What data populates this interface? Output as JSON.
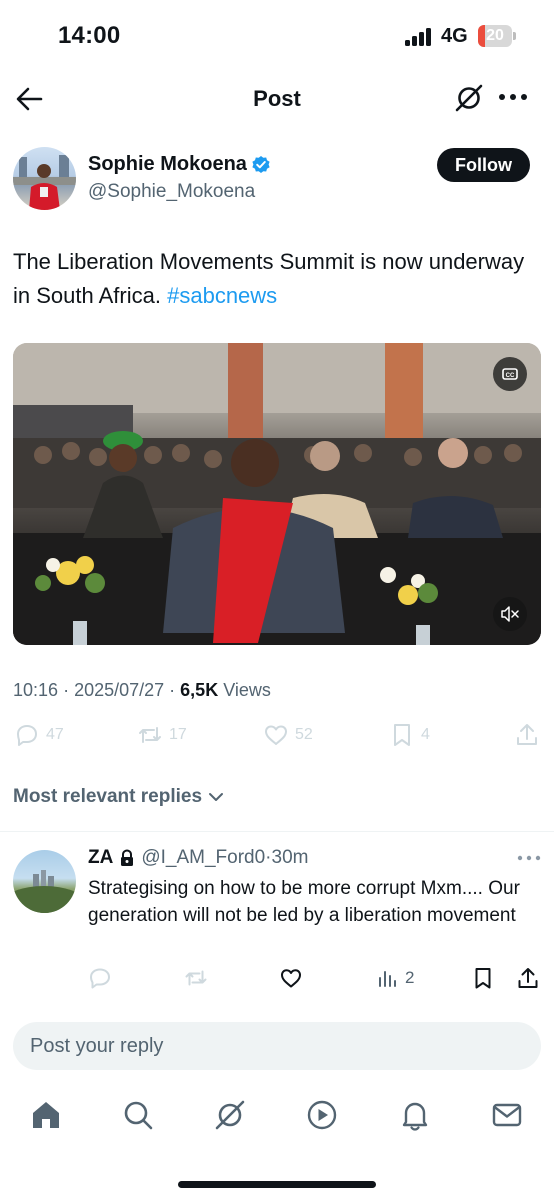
{
  "status_bar": {
    "time": "14:00",
    "network": "4G",
    "battery_level": "20",
    "battery_fraction": 0.2,
    "battery_color": "#eb4d3d"
  },
  "header": {
    "title": "Post",
    "back_icon": "arrow-left-icon",
    "grok_icon": "grok-icon",
    "more_icon": "more-horizontal-icon"
  },
  "post": {
    "author": {
      "name": "Sophie Mokoena",
      "handle": "@Sophie_Mokoena",
      "verified": true
    },
    "follow_label": "Follow",
    "text": "The Liberation Movements Summit is now underway in South Africa.",
    "hashtag": "#sabcnews",
    "meta": {
      "time": "10:16",
      "date": "2025/07/27",
      "views_count": "6,5K",
      "views_label": "Views"
    },
    "actions": {
      "replies": "47",
      "reposts": "17",
      "likes": "52",
      "bookmarks": "4"
    }
  },
  "replies_section": {
    "sort_label": "Most relevant replies"
  },
  "reply": {
    "name": "ZA",
    "handle": "@I_AM_Ford0",
    "separator": "·",
    "time": "30m",
    "text": "Strategising on how to be more corrupt Mxm.... Our generation will not be led by a liberation movement",
    "views": "2"
  },
  "compose": {
    "placeholder": "Post your reply"
  },
  "tabbar": {
    "items": [
      "home-icon",
      "search-icon",
      "grok-icon",
      "video-icon",
      "notifications-icon",
      "messages-icon"
    ]
  },
  "colors": {
    "accent": "#1d9bf0",
    "text": "#0f1419",
    "secondary": "#536471"
  }
}
